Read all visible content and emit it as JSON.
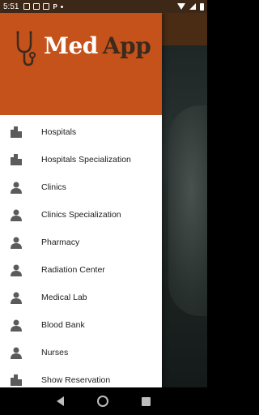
{
  "status_bar": {
    "time": "5:51",
    "notification_icons": [
      "image-icon",
      "gallery-icon",
      "mail-icon",
      "p-icon",
      "dot-icon"
    ],
    "p_label": "P",
    "system_icons": [
      "wifi-icon",
      "signal-icon",
      "battery-icon"
    ]
  },
  "drawer": {
    "header_color": "#c4521a",
    "logo": {
      "part1": "Med",
      "part2": "App",
      "part1_color": "#ffffff",
      "part2_color": "#3b2a1e",
      "icon": "stethoscope-icon"
    },
    "items": [
      {
        "label": "Hospitals",
        "icon": "building-icon"
      },
      {
        "label": "Hospitals Specialization",
        "icon": "building-icon"
      },
      {
        "label": "Clinics",
        "icon": "person-icon"
      },
      {
        "label": "Clinics Specialization",
        "icon": "person-icon"
      },
      {
        "label": "Pharmacy",
        "icon": "person-icon"
      },
      {
        "label": "Radiation Center",
        "icon": "person-icon"
      },
      {
        "label": "Medical Lab",
        "icon": "person-icon"
      },
      {
        "label": "Blood Bank",
        "icon": "person-icon"
      },
      {
        "label": "Nurses",
        "icon": "person-icon"
      },
      {
        "label": "Show Reservation",
        "icon": "building-icon"
      }
    ]
  },
  "nav_bar": {
    "buttons": [
      "back-icon",
      "home-icon",
      "recent-apps-icon"
    ]
  }
}
